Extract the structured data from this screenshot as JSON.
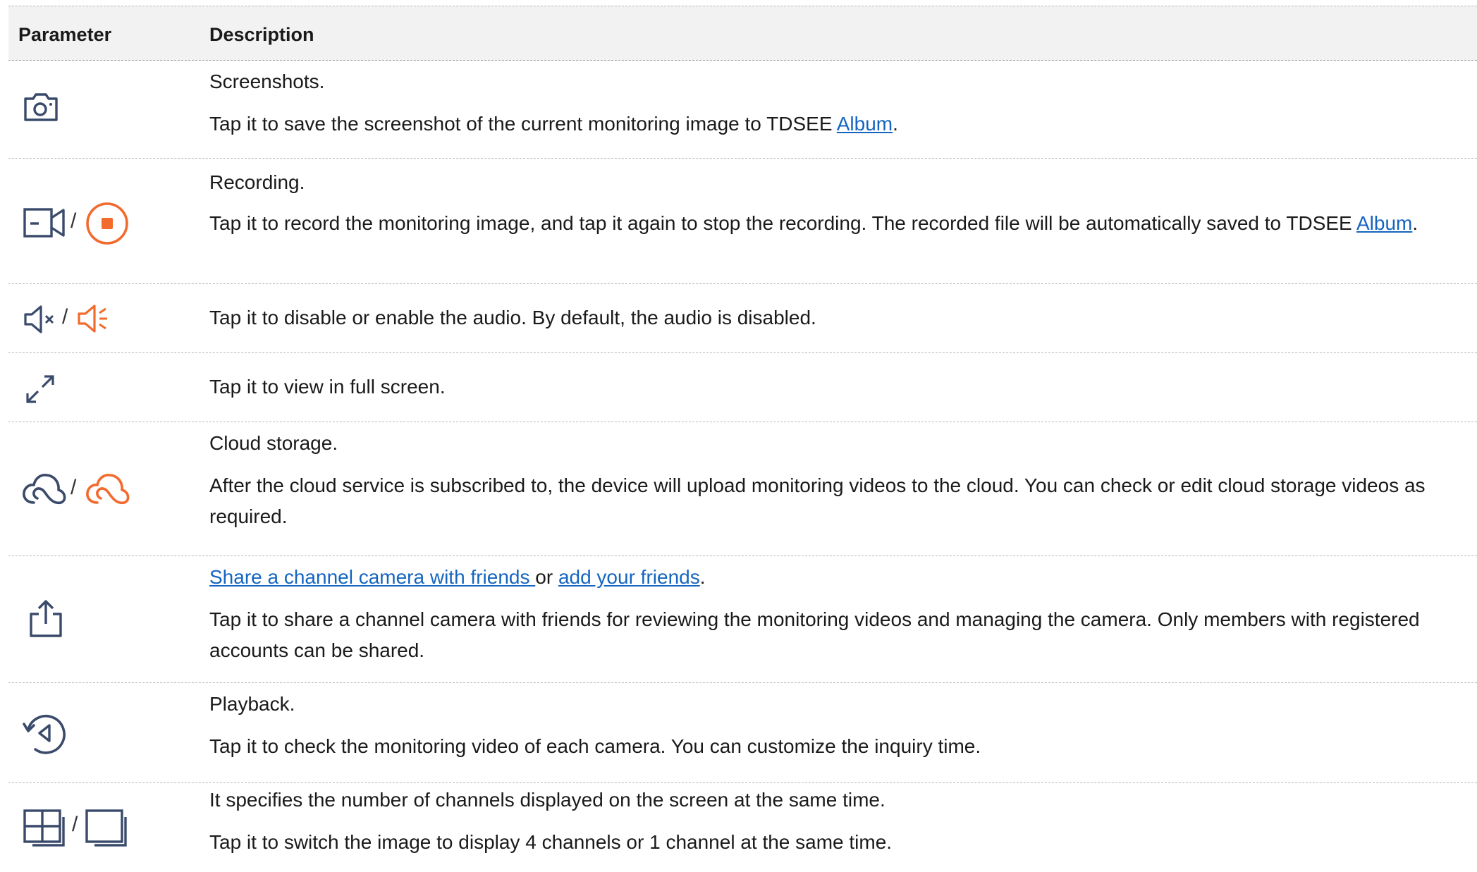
{
  "header": {
    "param": "Parameter",
    "desc": "Description"
  },
  "colors": {
    "icon_dark": "#3a4a6b",
    "icon_active": "#f26a2e",
    "link": "#1565c0"
  },
  "rows": [
    {
      "icons": [
        "camera-icon"
      ],
      "line1": "Screenshots.",
      "line2_pre": "Tap it to save the screenshot of the current monitoring image to TDSEE ",
      "line2_link": "Album",
      "line2_post": "."
    },
    {
      "icons": [
        "video-camera-icon",
        "stop-record-icon"
      ],
      "slash": "/",
      "line1": "Recording.",
      "line2_pre": "Tap it to record the monitoring image, and tap it again to stop the recording. The recorded file will be automatically saved to TDSEE ",
      "line2_link": "Album",
      "line2_post": "."
    },
    {
      "icons": [
        "speaker-muted-icon",
        "speaker-on-icon"
      ],
      "slash": "/",
      "line1": "Tap it to disable or enable the audio. By default, the audio is disabled."
    },
    {
      "icons": [
        "fullscreen-icon"
      ],
      "line1": "Tap it to view in full screen."
    },
    {
      "icons": [
        "cloud-icon",
        "cloud-active-icon"
      ],
      "slash": "/",
      "line1": "Cloud storage.",
      "line2": "After the cloud service is subscribed to, the device will upload monitoring videos to the cloud. You can check or edit cloud storage videos as required."
    },
    {
      "icons": [
        "share-icon"
      ],
      "link1": "Share a channel camera with friends ",
      "mid": "or ",
      "link2": "add your friends",
      "end": ".",
      "line2": "Tap it to share a channel camera with friends for reviewing the monitoring videos and managing the camera. Only members with registered accounts can be shared."
    },
    {
      "icons": [
        "playback-icon"
      ],
      "line1": "Playback.",
      "line2": "Tap it to check the monitoring video of each camera. You can customize the inquiry time."
    },
    {
      "icons": [
        "four-channel-icon",
        "one-channel-icon"
      ],
      "slash": "/",
      "line1": "It specifies the number of channels displayed on the screen at the same time.",
      "line2": "Tap it to switch the image to display 4 channels or 1 channel at the same time."
    }
  ]
}
